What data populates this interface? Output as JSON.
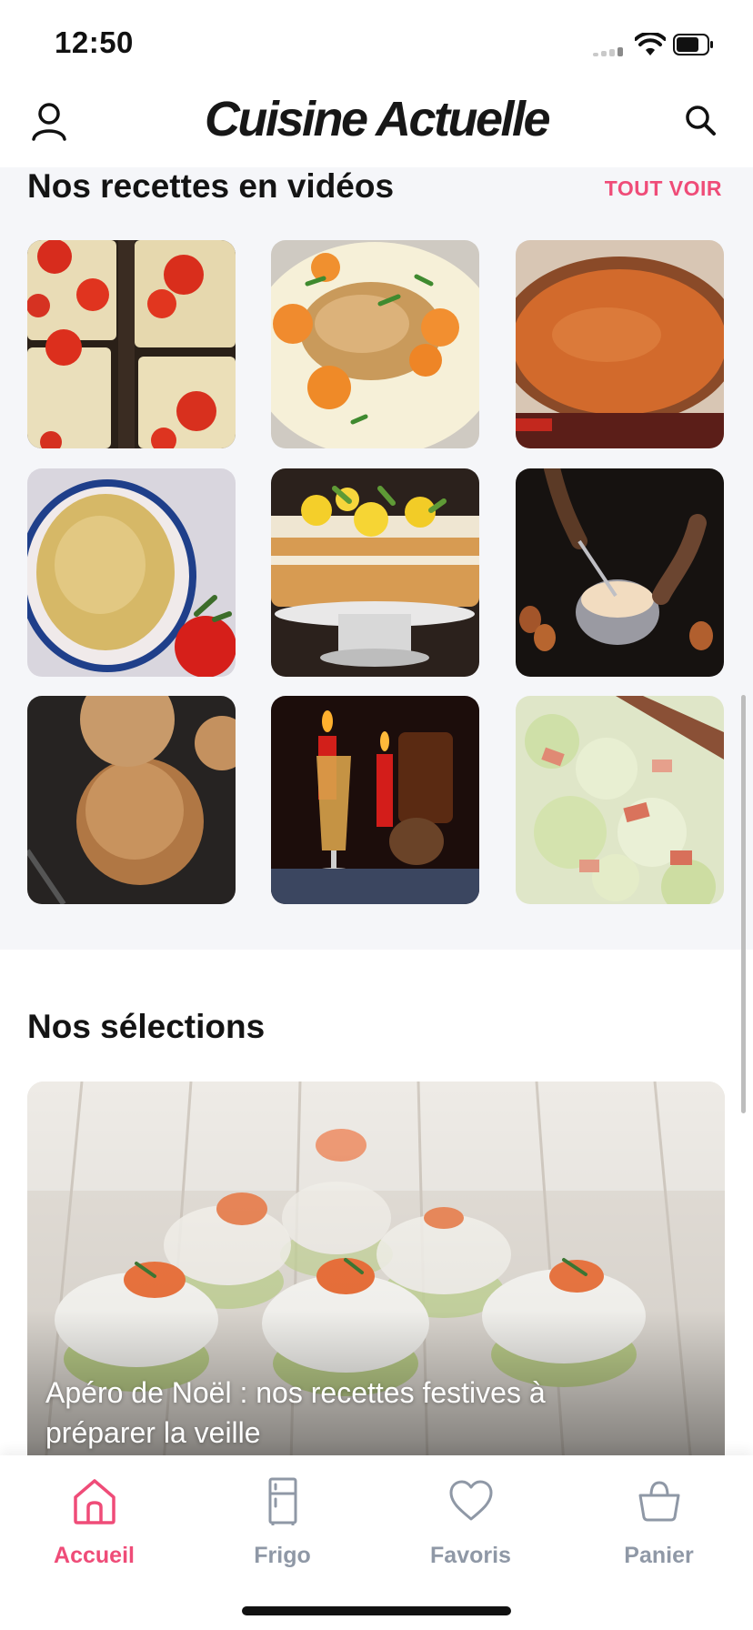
{
  "status_bar": {
    "time": "12:50",
    "icons": [
      "cellular-signal-icon",
      "wifi-icon",
      "battery-icon"
    ]
  },
  "header": {
    "brand": "Cuisine Actuelle",
    "left_icon": "user-icon",
    "right_icon": "search-icon"
  },
  "videos": {
    "title": "Nos recettes en vidéos",
    "see_all_label": "TOUT VOIR",
    "tiles": [
      {
        "subject": "tomato-tartines"
      },
      {
        "subject": "chicken-with-apricots"
      },
      {
        "subject": "tomato-soup-in-pot"
      },
      {
        "subject": "gratin"
      },
      {
        "subject": "lemon-cake"
      },
      {
        "subject": "whisking-batter"
      },
      {
        "subject": "bread-rolls"
      },
      {
        "subject": "mulled-drink-with-candles"
      },
      {
        "subject": "cabbage-salad"
      }
    ]
  },
  "selections": {
    "title": "Nos sélections",
    "card": {
      "caption": "Apéro de Noël : nos recettes festives à préparer la veille",
      "image": "festive-appetizer-cups"
    }
  },
  "tab_bar": {
    "items": [
      {
        "label": "Accueil",
        "icon": "home-icon",
        "active": true
      },
      {
        "label": "Frigo",
        "icon": "fridge-icon",
        "active": false
      },
      {
        "label": "Favoris",
        "icon": "heart-icon",
        "active": false
      },
      {
        "label": "Panier",
        "icon": "basket-icon",
        "active": false
      }
    ]
  },
  "colors": {
    "accent": "#ef4c78",
    "tab_inactive": "#8f98a6",
    "section_background": "#f5f6f9"
  }
}
